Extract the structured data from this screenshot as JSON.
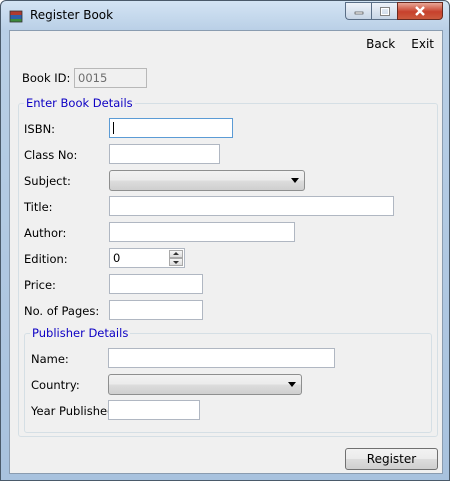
{
  "window": {
    "title": "Register Book",
    "icon": "book-stack-icon"
  },
  "menu": {
    "back": "Back",
    "exit": "Exit"
  },
  "book_id": {
    "label": "Book ID:",
    "value": "0015"
  },
  "book_details": {
    "title": "Enter Book Details",
    "isbn_label": "ISBN:",
    "isbn_value": "",
    "class_no_label": "Class No:",
    "class_no_value": "",
    "subject_label": "Subject:",
    "subject_value": "",
    "title_label": "Title:",
    "title_value": "",
    "author_label": "Author:",
    "author_value": "",
    "edition_label": "Edition:",
    "edition_value": "0",
    "price_label": "Price:",
    "price_value": "",
    "pages_label": "No. of Pages:",
    "pages_value": ""
  },
  "publisher_details": {
    "title": "Publisher Details",
    "name_label": "Name:",
    "name_value": "",
    "country_label": "Country:",
    "country_value": "",
    "year_label": "Year Published:",
    "year_value": ""
  },
  "actions": {
    "register": "Register"
  },
  "colors": {
    "group_title": "#0d00c4",
    "close_button": "#c7412c"
  }
}
